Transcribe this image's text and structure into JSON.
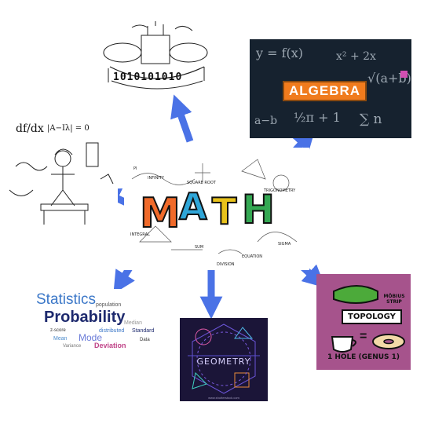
{
  "center": {
    "letters": [
      "M",
      "A",
      "T",
      "H"
    ],
    "tags": [
      "TRIGONOMETRY",
      "INTEGRAL",
      "SQUARE ROOT",
      "EQUATION",
      "INFINITY",
      "DIVISION",
      "PI",
      "SIGMA",
      "SUM"
    ]
  },
  "computer": {
    "binary": "1010101010"
  },
  "algebra": {
    "label": "ALGEBRA",
    "scribbles": [
      "y = f(x)",
      "x² + 2x",
      "√(a+b)",
      "½π + 1",
      "∑ n",
      "a−b"
    ]
  },
  "calculus": {
    "formulas": [
      "df/dx",
      "|A−Iλ| = 0"
    ]
  },
  "statistics": {
    "words": [
      "Statistics",
      "Probability",
      "population",
      "distributed",
      "Mode",
      "Deviation",
      "Standard",
      "Mean",
      "Median",
      "z-score",
      "Data",
      "Variance"
    ]
  },
  "geometry": {
    "title": "GEOMETRY",
    "credit": "www.shutterstock.com"
  },
  "topology": {
    "strip_label": "MÖBIUS STRIP",
    "title": "TOPOLOGY",
    "equals": "=",
    "caption": "1 HOLE (GENUS 1)"
  }
}
